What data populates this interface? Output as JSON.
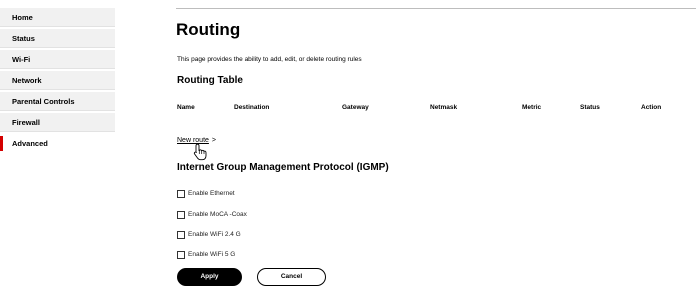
{
  "sidebar": {
    "items": [
      {
        "label": "Home"
      },
      {
        "label": "Status"
      },
      {
        "label": "Wi-Fi"
      },
      {
        "label": "Network"
      },
      {
        "label": "Parental Controls"
      },
      {
        "label": "Firewall"
      },
      {
        "label": "Advanced",
        "active": true
      }
    ]
  },
  "page": {
    "title": "Routing",
    "description": "This page provides the ability to add, edit, or delete routing rules"
  },
  "routing_table": {
    "heading": "Routing Table",
    "columns": [
      "Name",
      "Destination",
      "Gateway",
      "Netmask",
      "Metric",
      "Status",
      "Action"
    ]
  },
  "new_route": {
    "label": "New route",
    "chevron": ">"
  },
  "igmp": {
    "heading": "Internet Group Management Protocol (IGMP)",
    "options": [
      {
        "label": "Enable Ethernet",
        "checked": false
      },
      {
        "label": "Enable MoCA -Coax",
        "checked": false
      },
      {
        "label": "Enable WiFi 2.4 G",
        "checked": false
      },
      {
        "label": "Enable WiFi 5 G",
        "checked": false
      }
    ]
  },
  "buttons": {
    "apply": "Apply",
    "cancel": "Cancel"
  },
  "colors": {
    "accent": "#d40000",
    "sidebar_bg": "#f1f1f1",
    "primary_button": "#000000"
  },
  "icons": {
    "cursor": "hand-pointer-icon",
    "chevron": "chevron-right-icon"
  }
}
